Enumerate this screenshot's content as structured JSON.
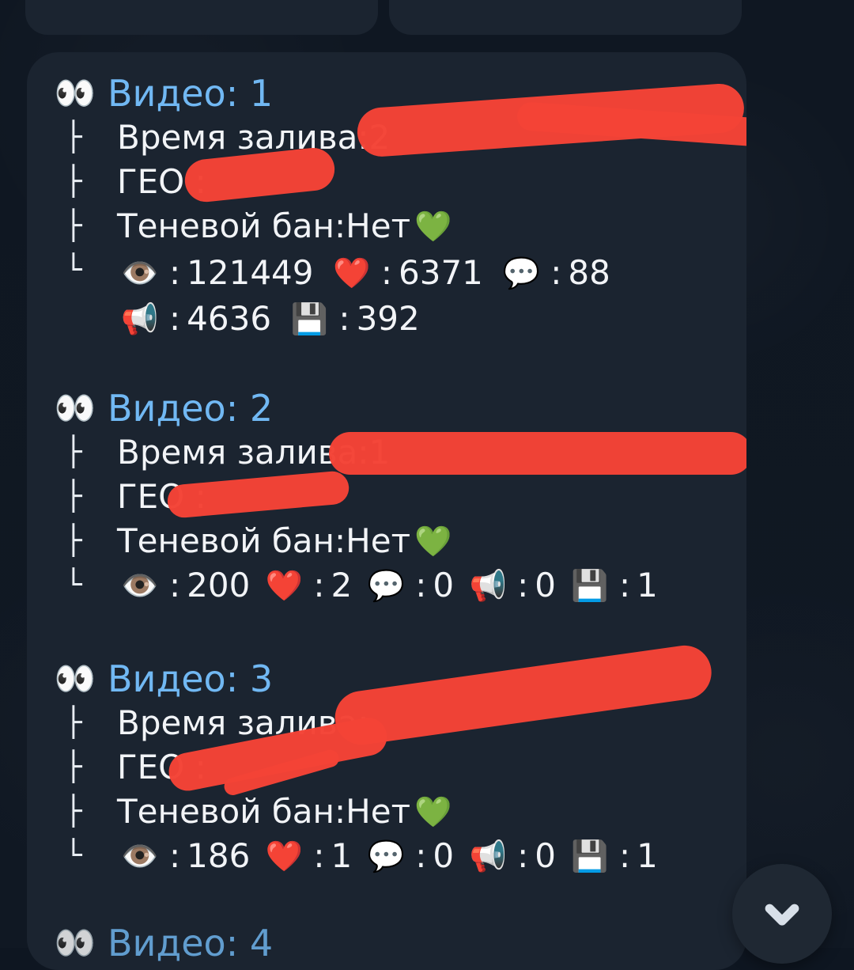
{
  "videos": [
    {
      "title": "Видео: 1",
      "upload_label": "Время залива:",
      "upload_value": "2",
      "geo_label": "ГЕО :",
      "shadowban_label": "Теневой бан:",
      "shadowban_value": "Нет",
      "metrics": {
        "views": "121449",
        "likes": "6371",
        "comments": "88",
        "shares": "4636",
        "saves": "392"
      }
    },
    {
      "title": "Видео: 2",
      "upload_label": "Время залива:",
      "upload_value": "1",
      "geo_label": "ГЕО :",
      "shadowban_label": "Теневой бан:",
      "shadowban_value": "Нет",
      "metrics": {
        "views": "200",
        "likes": "2",
        "comments": "0",
        "shares": "0",
        "saves": "1"
      }
    },
    {
      "title": "Видео: 3",
      "upload_label": "Время залива:",
      "upload_value": "",
      "geo_label": "ГЕО :",
      "shadowban_label": "Теневой бан:",
      "shadowban_value": "Нет",
      "metrics": {
        "views": "186",
        "likes": "1",
        "comments": "0",
        "shares": "0",
        "saves": "1"
      }
    },
    {
      "title": "Видео: 4"
    }
  ],
  "icons": {
    "eyes": "eyes-icon",
    "green_heart": "green-heart-icon",
    "eye": "eye-icon",
    "heart": "heart-icon",
    "speech": "speech-bubble-icon",
    "megaphone": "megaphone-icon",
    "floppy": "floppy-disk-icon",
    "chevron": "chevron-down-icon"
  },
  "colors": {
    "background": "#0e1621",
    "bubble": "#1b2430",
    "title_blue": "#71b8f3",
    "text": "#f2f4f7",
    "redaction": "#f44336",
    "scroll_button": "#1f2833"
  }
}
